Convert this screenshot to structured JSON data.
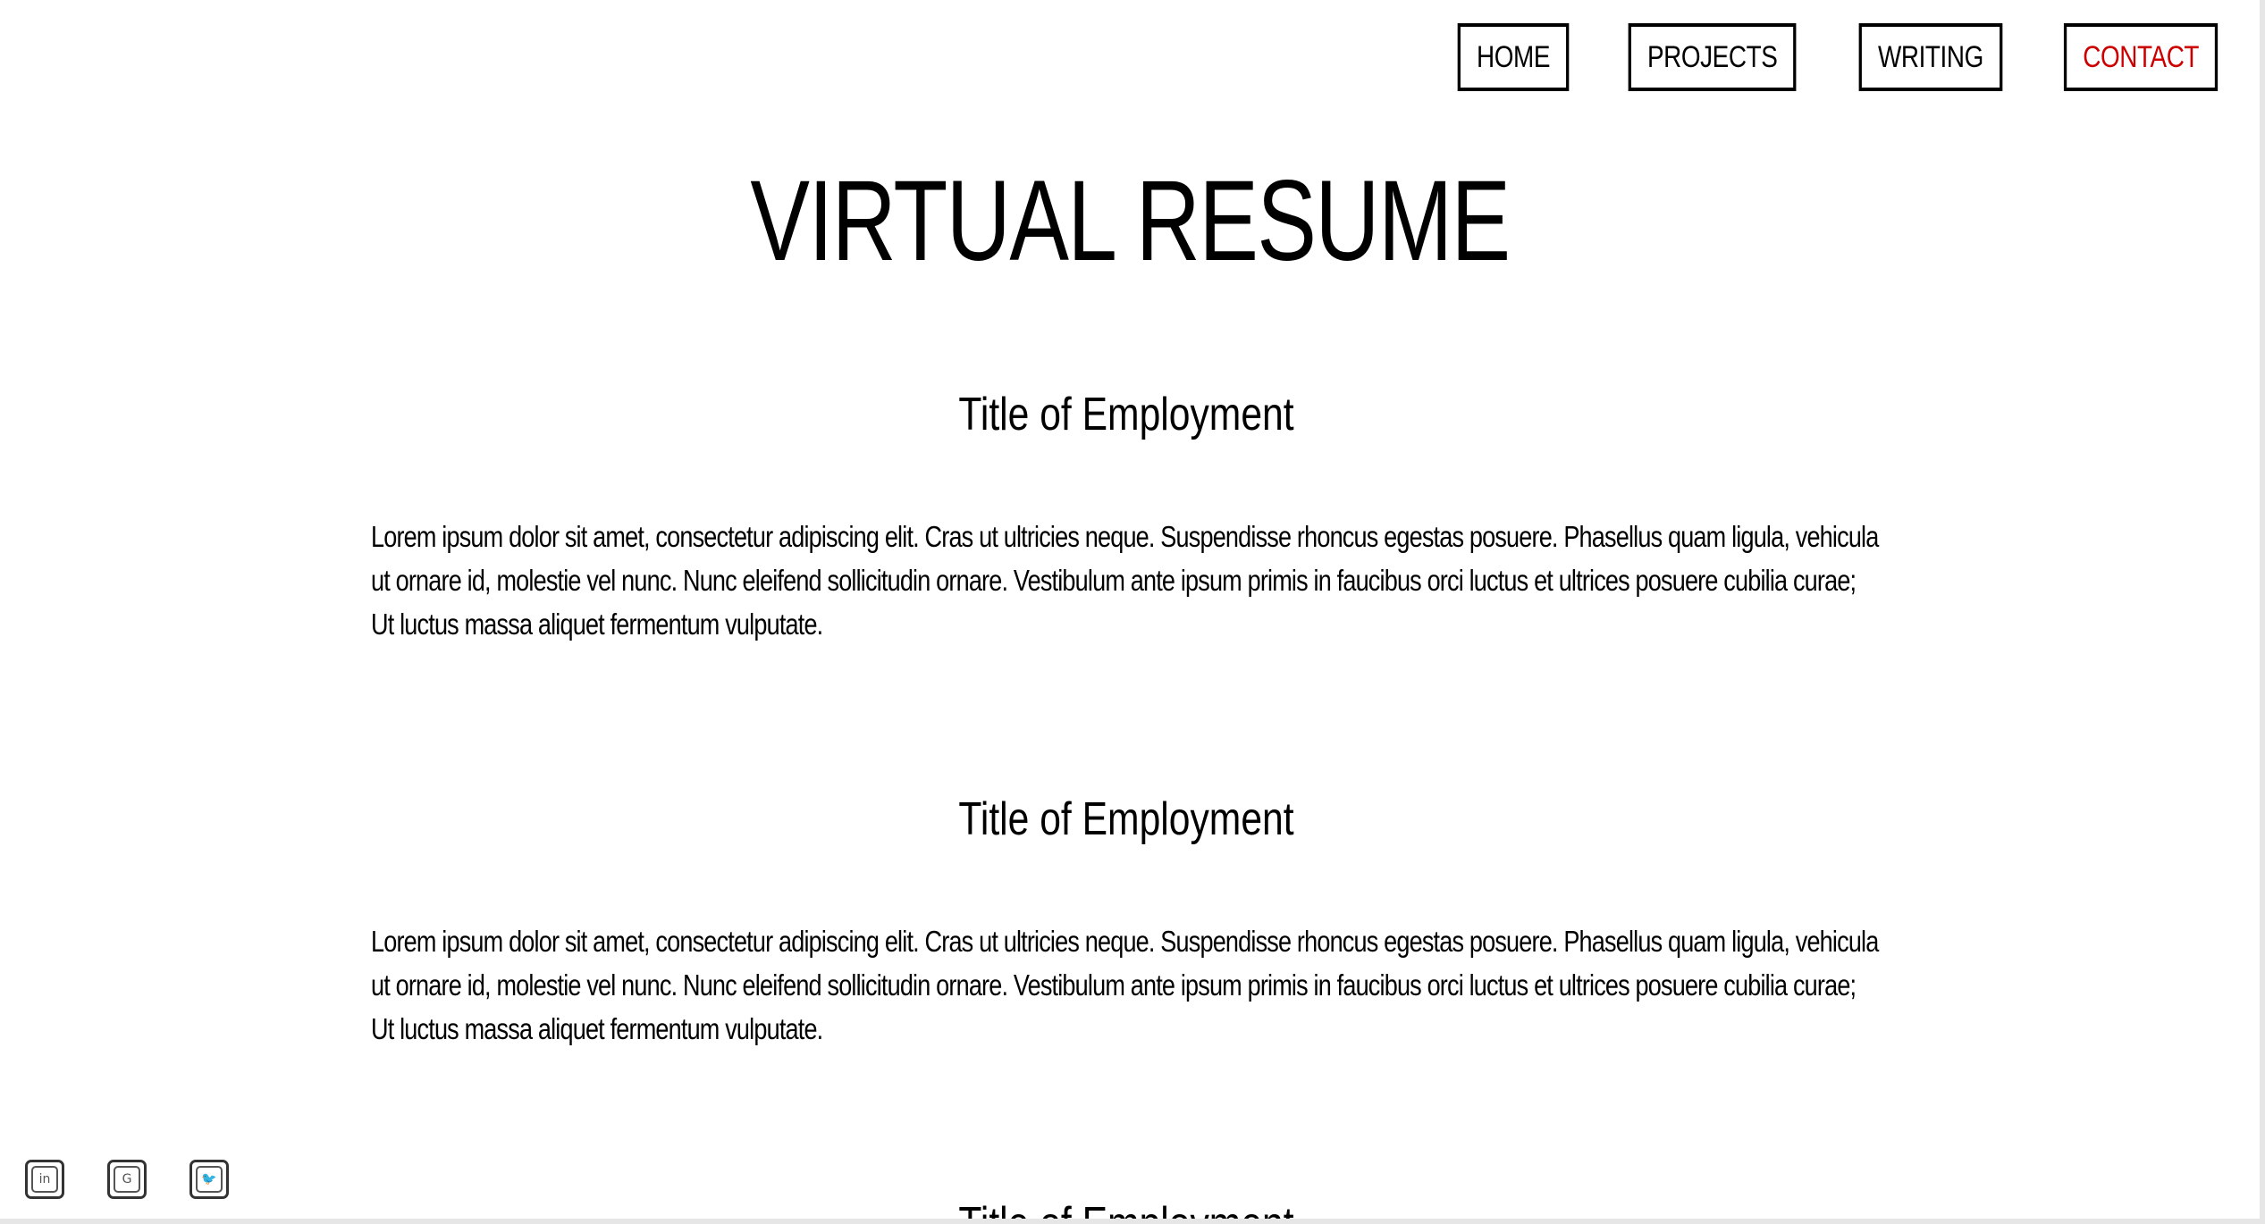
{
  "nav": {
    "items": [
      {
        "label": "HOME"
      },
      {
        "label": "PROJECTS"
      },
      {
        "label": "WRITING"
      },
      {
        "label": "CONTACT"
      }
    ],
    "active_color": "#cc0000"
  },
  "header": {
    "title": "VIRTUAL RESUME"
  },
  "sections": [
    {
      "title": "Title of Employment",
      "body": "Lorem ipsum dolor sit amet, consectetur adipiscing elit. Cras ut ultricies neque. Suspendisse rhoncus egestas posuere. Phasellus quam ligula, vehicula ut ornare id, molestie vel nunc. Nunc eleifend sollicitudin ornare. Vestibulum ante ipsum primis in faucibus orci luctus et ultrices posuere cubilia curae; Ut luctus massa aliquet fermentum vulputate."
    },
    {
      "title": "Title of Employment",
      "body": "Lorem ipsum dolor sit amet, consectetur adipiscing elit. Cras ut ultricies neque. Suspendisse rhoncus egestas posuere. Phasellus quam ligula, vehicula ut ornare id, molestie vel nunc. Nunc eleifend sollicitudin ornare. Vestibulum ante ipsum primis in faucibus orci luctus et ultrices posuere cubilia curae; Ut luctus massa aliquet fermentum vulputate."
    },
    {
      "title": "Title of Employment"
    }
  ],
  "social": {
    "icons": [
      {
        "icon": "linkedin-icon",
        "glyph": "in"
      },
      {
        "icon": "google-icon",
        "glyph": "G"
      },
      {
        "icon": "twitter-icon",
        "glyph": "🐦"
      }
    ]
  }
}
